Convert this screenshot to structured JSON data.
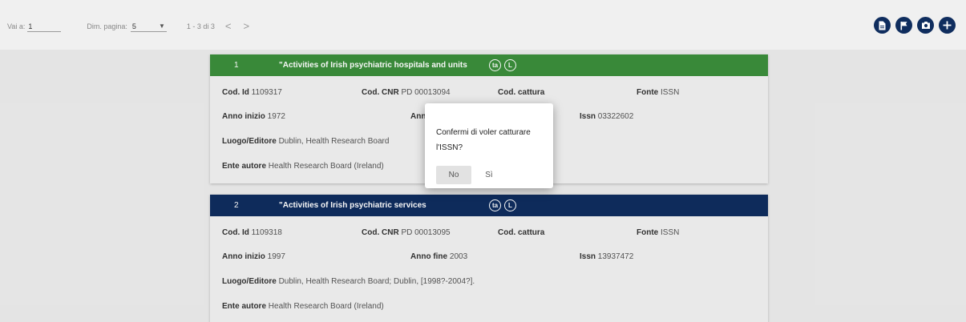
{
  "pager": {
    "goto_label": "Vai a:",
    "goto_value": "1",
    "size_label": "Dim. pagina:",
    "size_value": "5",
    "range": "1 - 3 di 3",
    "prev": "<",
    "next": ">"
  },
  "actions": [
    {
      "name": "document-icon"
    },
    {
      "name": "flag-icon"
    },
    {
      "name": "camera-icon"
    },
    {
      "name": "add-icon"
    }
  ],
  "colors": {
    "accent_green": "#3b8e3b",
    "accent_navy": "#0f2d5e"
  },
  "records": [
    {
      "number": "1",
      "title": "\"Activities of Irish psychiatric hospitals and units",
      "badges": [
        "ta",
        "L"
      ],
      "cod_id_label": "Cod. Id",
      "cod_id": "1109317",
      "cod_cnr_label": "Cod. CNR",
      "cod_cnr": "PD 00013094",
      "cattura_label": "Cod. cattura",
      "fonte_label": "Fonte",
      "fonte": "ISSN",
      "anno_inizio_label": "Anno inizio",
      "anno_inizio": "1972",
      "anno_fine_label": "Anno",
      "issn_label": "Issn",
      "issn": "03322602",
      "luogo_label": "Luogo/Editore",
      "luogo": "Dublin, Health Research Board",
      "ente_label": "Ente autore",
      "ente": "Health Research Board (Ireland)"
    },
    {
      "number": "2",
      "title": "\"Activities of Irish psychiatric services",
      "badges": [
        "ta",
        "L"
      ],
      "cod_id_label": "Cod. Id",
      "cod_id": "1109318",
      "cod_cnr_label": "Cod. CNR",
      "cod_cnr": "PD 00013095",
      "cattura_label": "Cod. cattura",
      "fonte_label": "Fonte",
      "fonte": "ISSN",
      "anno_inizio_label": "Anno inizio",
      "anno_inizio": "1997",
      "anno_fine_label": "Anno fine",
      "anno_fine": "2003",
      "issn_label": "Issn",
      "issn": "13937472",
      "luogo_label": "Luogo/Editore",
      "luogo": "Dublin, Health Research Board; Dublin, [1998?-2004?].",
      "ente_label": "Ente autore",
      "ente": "Health Research Board (Ireland)"
    }
  ],
  "dialog": {
    "message": "Confermi di voler catturare l'ISSN?",
    "no_label": "No",
    "si_label": "Sì"
  }
}
